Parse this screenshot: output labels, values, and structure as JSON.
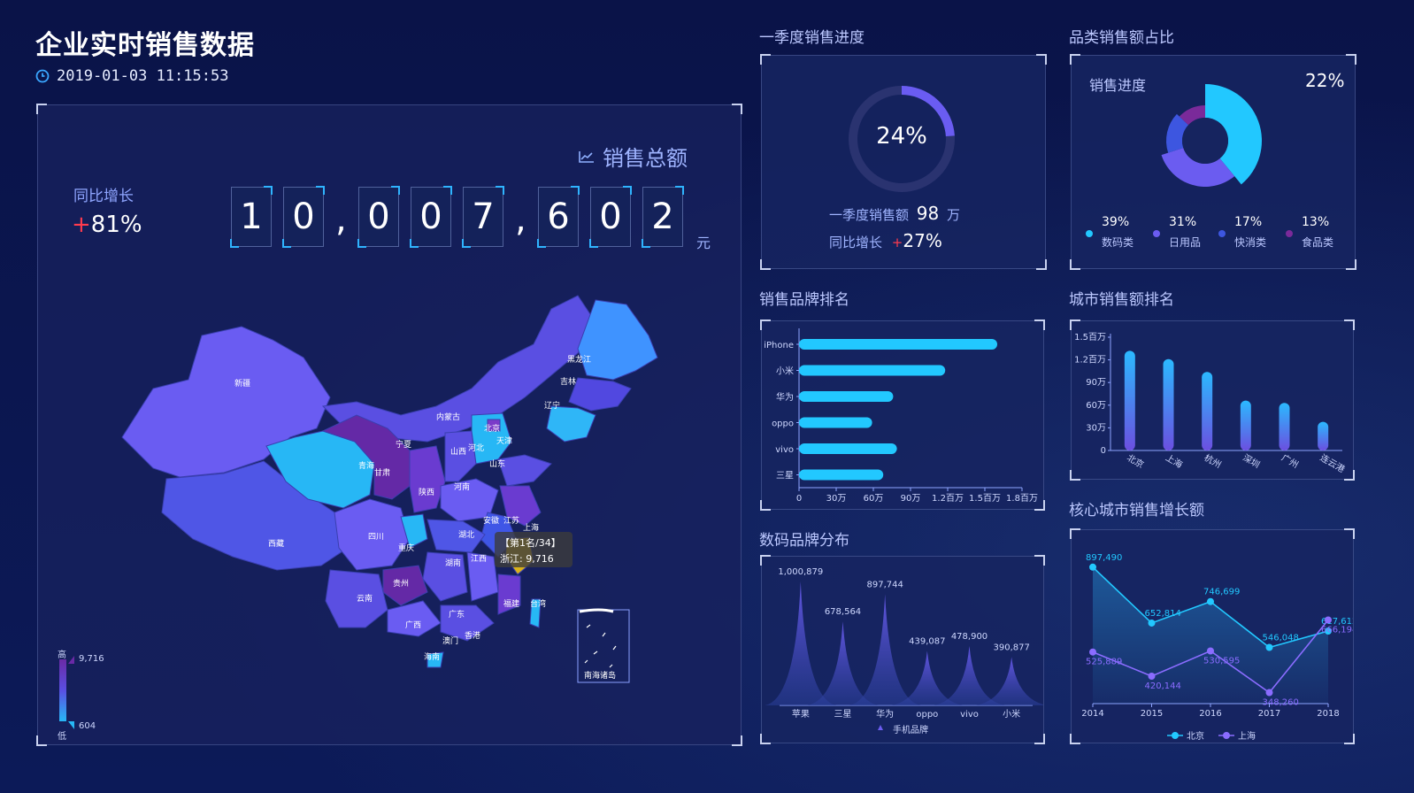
{
  "header": {
    "title": "企业实时销售数据",
    "datetime": "2019-01-03 11:15:53"
  },
  "map_panel": {
    "total_label": "销售总额",
    "total_digits": [
      "1",
      "0",
      ",",
      "0",
      "0",
      "7",
      ",",
      "6",
      "0",
      "2"
    ],
    "currency": "元",
    "yoy_label": "同比增长",
    "yoy_sign": "+",
    "yoy_value": "81%",
    "legend_high": "高",
    "legend_low": "低",
    "legend_max": "9,716",
    "legend_min": "604",
    "tooltip_rank": "【第1名/34】",
    "tooltip_value": "浙江: 9,716",
    "south_sea_label": "南海诸岛",
    "provinces": [
      "新疆",
      "西藏",
      "青海",
      "甘肃",
      "宁夏",
      "内蒙古",
      "黑龙江",
      "吉林",
      "辽宁",
      "北京",
      "天津",
      "河北",
      "山西",
      "山东",
      "陕西",
      "河南",
      "江苏",
      "安徽",
      "上海",
      "四川",
      "重庆",
      "湖北",
      "湖南",
      "江西",
      "浙江",
      "福建",
      "台湾",
      "贵州",
      "云南",
      "广西",
      "广东",
      "澳门",
      "香港",
      "海南"
    ]
  },
  "q1_panel": {
    "section_title": "一季度销售进度",
    "progress": "24%",
    "progress_value": 0.24,
    "sales_label": "一季度销售额",
    "sales_value": "98",
    "sales_unit": "万",
    "yoy_label": "同比增长",
    "yoy_sign": "+",
    "yoy_value": "27%"
  },
  "category_panel": {
    "section_title": "品类销售额占比",
    "progress_label": "销售进度",
    "progress_value": "22%",
    "items": [
      {
        "pct": "39%",
        "name": "数码类",
        "value": 39,
        "color": "#22c8ff"
      },
      {
        "pct": "31%",
        "name": "日用品",
        "value": 31,
        "color": "#6b5cf0"
      },
      {
        "pct": "17%",
        "name": "快消类",
        "value": 17,
        "color": "#3d56e0"
      },
      {
        "pct": "13%",
        "name": "食品类",
        "value": 13,
        "color": "#7a2a9a"
      }
    ]
  },
  "brand_rank_panel": {
    "section_title": "销售品牌排名",
    "chart_data": {
      "type": "bar",
      "orientation": "horizontal",
      "categories": [
        "iPhone",
        "小米",
        "华为",
        "oppo",
        "vivo",
        "三星"
      ],
      "values": [
        1600000,
        1180000,
        760000,
        590000,
        790000,
        680000
      ],
      "xlim": [
        0,
        1800000
      ],
      "xticks": [
        "0",
        "30万",
        "60万",
        "90万",
        "1.2百万",
        "1.5百万",
        "1.8百万"
      ],
      "color": "#22c8ff"
    }
  },
  "city_rank_panel": {
    "section_title": "城市销售额排名",
    "chart_data": {
      "type": "bar",
      "categories": [
        "北京",
        "上海",
        "杭州",
        "深圳",
        "广州",
        "连云港"
      ],
      "values": [
        1320000,
        1210000,
        1040000,
        660000,
        630000,
        380000
      ],
      "ylim": [
        0,
        1500000
      ],
      "yticks": [
        "0",
        "30万",
        "60万",
        "90万",
        "1.2百万",
        "1.5百万"
      ],
      "colors": [
        "#2bb9ff",
        "#6b4fe0"
      ]
    }
  },
  "digital_brand_panel": {
    "section_title": "数码品牌分布",
    "chart_data": {
      "type": "area",
      "categories": [
        "苹果",
        "三星",
        "华为",
        "oppo",
        "vivo",
        "小米"
      ],
      "values": [
        1000879,
        678564,
        897744,
        439087,
        478900,
        390877
      ],
      "labels": [
        "1,000,879",
        "678,564",
        "897,744",
        "439,087",
        "478,900",
        "390,877"
      ],
      "legend": "手机品牌"
    }
  },
  "city_growth_panel": {
    "section_title": "核心城市销售增长额",
    "chart_data": {
      "type": "line",
      "x": [
        "2014",
        "2015",
        "2016",
        "2017",
        "2018"
      ],
      "series": [
        {
          "name": "北京",
          "values": [
            897490,
            652814,
            746699,
            546048,
            617612
          ],
          "labels": [
            "897,490",
            "652,814",
            "746,699",
            "546,048",
            "617,612"
          ],
          "color": "#22c8ff"
        },
        {
          "name": "上海",
          "values": [
            525889,
            420144,
            530595,
            348260,
            666194
          ],
          "labels": [
            "525,889",
            "420,144",
            "530,595",
            "348,260",
            "666,194"
          ],
          "color": "#8a6cff"
        }
      ]
    }
  }
}
